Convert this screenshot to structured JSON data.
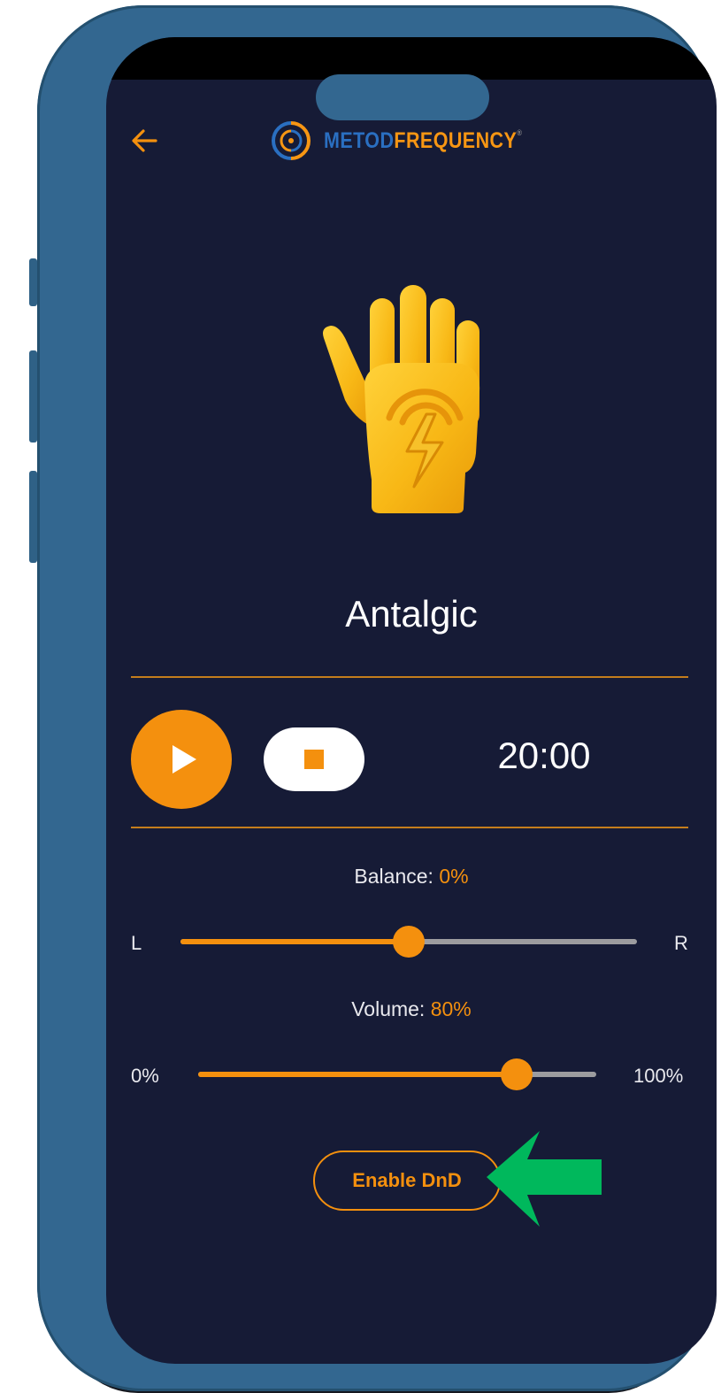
{
  "header": {
    "back_icon": "arrow-left-icon",
    "logo_part1": "METOD",
    "logo_part2": "FREQUENCY",
    "logo_registered": "®"
  },
  "program": {
    "icon": "hand-lightning-icon",
    "title": "Antalgic"
  },
  "player": {
    "play_icon": "play-icon",
    "stop_icon": "stop-icon",
    "timer": "20:00"
  },
  "balance": {
    "label": "Balance:",
    "value_text": "0%",
    "left_label": "L",
    "right_label": "R",
    "level": 0.5
  },
  "volume": {
    "label": "Volume:",
    "value_text": "80%",
    "min_label": "0%",
    "max_label": "100%",
    "level": 0.8
  },
  "dnd_button": {
    "label": "Enable DnD"
  },
  "annotation": {
    "icon": "green-pointer-arrow-icon",
    "color": "#00b85c"
  },
  "colors": {
    "accent": "#f4900e",
    "background": "#161b36",
    "device_frame": "#336790"
  }
}
